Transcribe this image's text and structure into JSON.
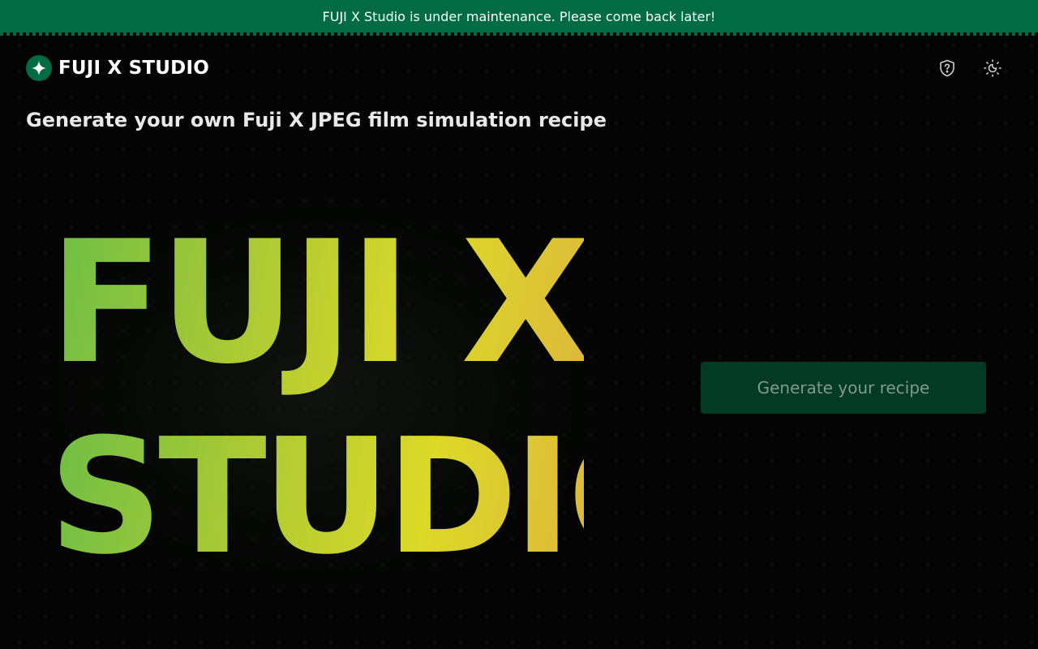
{
  "banner": {
    "message": "FUJI X Studio is under maintenance. Please come back later!"
  },
  "header": {
    "logo_text": "FUJI X STUDIO",
    "logo_icon": "sparkle-icon",
    "actions": [
      {
        "icon": "shield-question-icon"
      },
      {
        "icon": "theme-toggle-icon"
      }
    ]
  },
  "main": {
    "tagline": "Generate your own Fuji X JPEG film simulation recipe",
    "hero_line_1": "FUJI X",
    "hero_line_2": "STUDIO",
    "cta_label": "Generate your recipe"
  },
  "colors": {
    "brand_green": "#006b45",
    "button_bg": "#033a24",
    "button_text": "#7f9a8e",
    "hero_gradient": [
      "#6dbe45",
      "#a9c935",
      "#dcd927",
      "#ddb83c"
    ],
    "background": "#030403"
  }
}
